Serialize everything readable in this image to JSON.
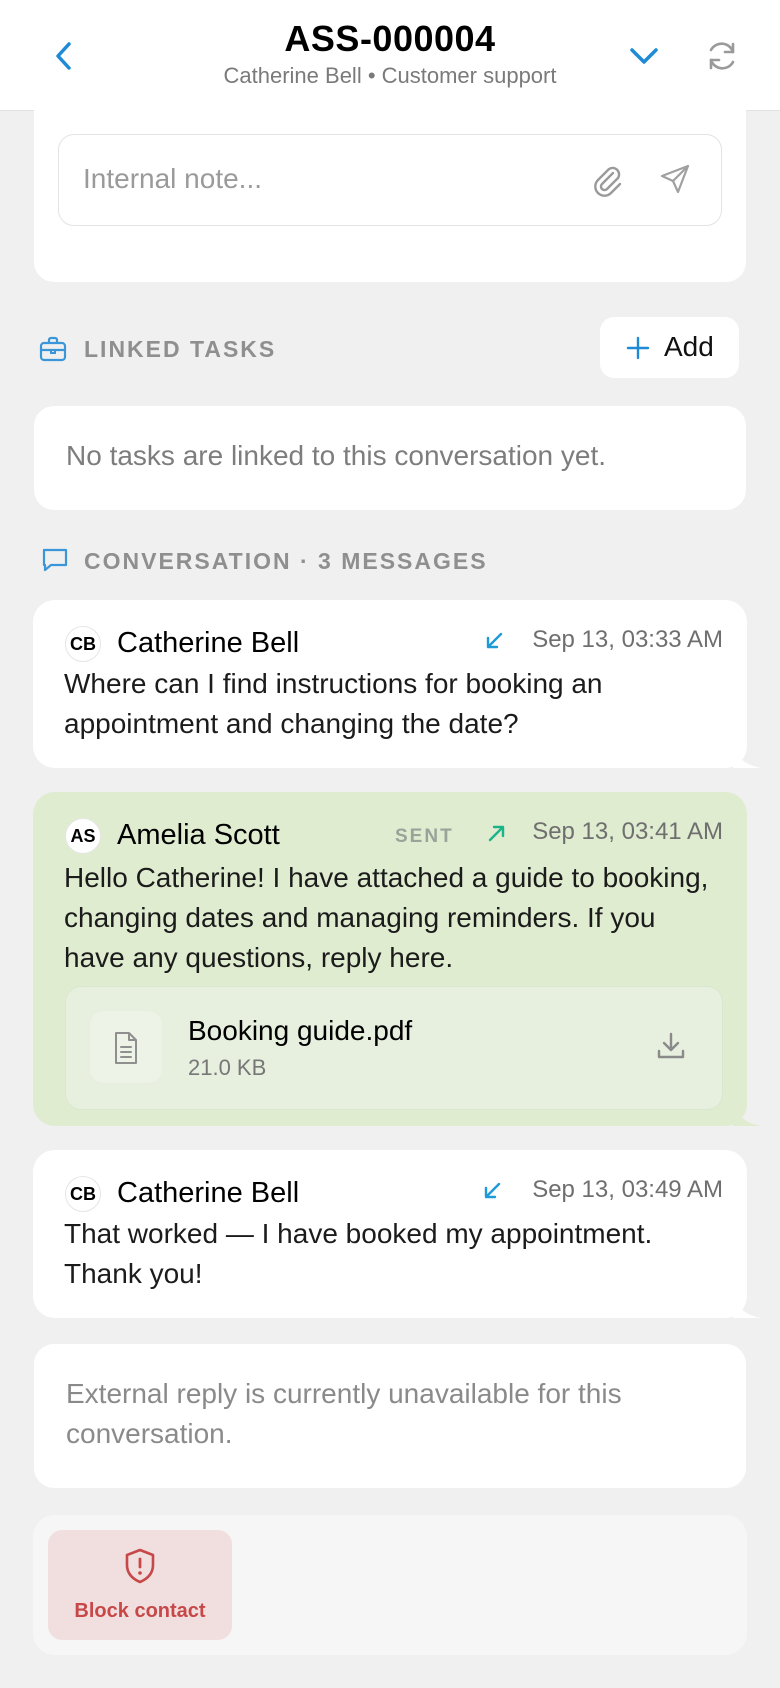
{
  "header": {
    "title": "ASS-000004",
    "subtitle": "Catherine Bell • Customer support"
  },
  "note": {
    "placeholder": "Internal note..."
  },
  "linked_tasks": {
    "label": "LINKED TASKS",
    "add_label": "Add",
    "empty_text": "No tasks are linked to this conversation yet."
  },
  "conversation": {
    "label": "CONVERSATION · 3 MESSAGES",
    "messages": [
      {
        "initials": "CB",
        "sender": "Catherine Bell",
        "direction": "incoming",
        "time": "Sep 13, 03:33 AM",
        "text": "Where can I find instructions for booking an appointment and changing the date?"
      },
      {
        "initials": "AS",
        "sender": "Amelia Scott",
        "direction": "outgoing",
        "status": "SENT",
        "time": "Sep 13, 03:41 AM",
        "text": "Hello Catherine! I have attached a guide to booking, changing dates and managing reminders. If you have any questions, reply here.",
        "attachment": {
          "name": "Booking guide.pdf",
          "size": "21.0 KB"
        }
      },
      {
        "initials": "CB",
        "sender": "Catherine Bell",
        "direction": "incoming",
        "time": "Sep 13, 03:49 AM",
        "text": "That worked — I have booked my appointment. Thank you!"
      }
    ]
  },
  "external_reply_notice": "External reply is currently unavailable for this conversation.",
  "block_contact_label": "Block contact",
  "colors": {
    "accent": "#1f8ad6",
    "incoming": "#1e9ad8",
    "outgoing": "#1db38a",
    "sent_bubble": "#dfecd0",
    "danger": "#c64848"
  }
}
